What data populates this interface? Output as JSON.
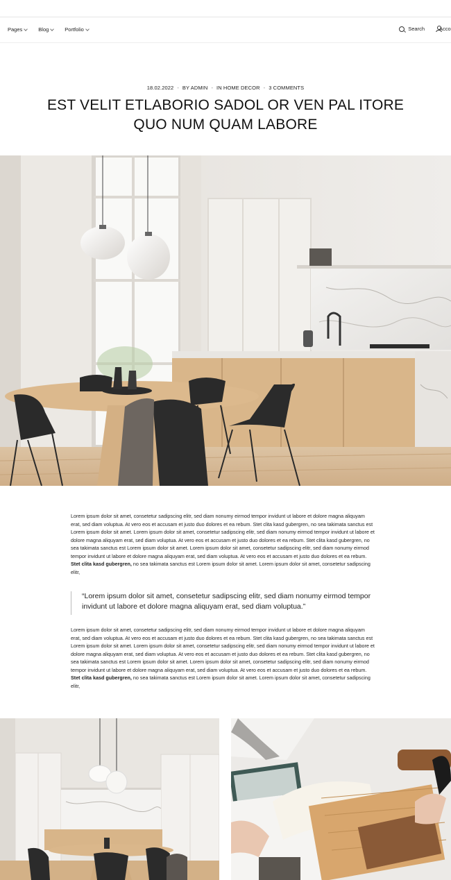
{
  "nav": {
    "items": [
      {
        "label": "Pages"
      },
      {
        "label": "Blog"
      },
      {
        "label": "Portfolio"
      }
    ],
    "search_label": "Search",
    "account_label": "Account"
  },
  "post": {
    "date": "18.02.2022",
    "author": "BY ADMIN",
    "category": "IN HOME DECOR",
    "comments": "3 COMMENTS",
    "title": "EST VELIT ETLABORIO SADOL OR VEN PAL ITORE QUO NUM QUAM LABORE"
  },
  "body": {
    "paragraph1": "Lorem ipsum dolor sit amet, consetetur sadipscing elitr, sed diam nonumy eirmod tempor invidunt ut labore et dolore magna aliquyam erat, sed diam voluptua. At vero eos et accusam et justo duo dolores et ea rebum. Stet clita kasd gubergren, no sea takimata sanctus est Lorem ipsum dolor sit amet. Lorem ipsum dolor sit amet, consetetur sadipscing elitr, sed diam nonumy eirmod tempor invidunt ut labore et dolore magna aliquyam erat, sed diam voluptua. At vero eos et accusam et justo duo dolores et ea rebum. Stet clita kasd gubergren, no sea takimata sanctus est Lorem ipsum dolor sit amet. Lorem ipsum dolor sit amet, consetetur sadipscing elitr, sed diam nonumy eirmod tempor invidunt ut labore et dolore magna aliquyam erat, sed diam voluptua. At vero eos et accusam et justo duo dolores et ea rebum.",
    "paragraph1_bold": "Stet clita kasd gubergren,",
    "paragraph1_tail": "no sea takimata sanctus est Lorem ipsum dolor sit amet. Lorem ipsum dolor sit amet, consetetur sadipscing elitr,",
    "quote": "“Lorem ipsum dolor sit amet, consetetur sadipscing elitr, sed diam nonumy eirmod tempor invidunt ut labore et dolore magna aliquyam erat, sed diam voluptua.”",
    "paragraph2": "Lorem ipsum dolor sit amet, consetetur sadipscing elitr, sed diam nonumy eirmod tempor invidunt ut labore et dolore magna aliquyam erat, sed diam voluptua. At vero eos et accusam et justo duo dolores et ea rebum. Stet clita kasd gubergren, no sea takimata sanctus est Lorem ipsum dolor sit amet. Lorem ipsum dolor sit amet, consetetur sadipscing elitr, sed diam nonumy eirmod tempor invidunt ut labore et dolore magna aliquyam erat, sed diam voluptua. At vero eos et accusam et justo duo dolores et ea rebum. Stet clita kasd gubergren, no sea takimata sanctus est Lorem ipsum dolor sit amet. Lorem ipsum dolor sit amet, consetetur sadipscing elitr, sed diam nonumy eirmod tempor invidunt ut labore et dolore magna aliquyam erat, sed diam voluptua. At vero eos et accusam et justo duo dolores et ea rebum.",
    "paragraph2_bold": "Stet clita kasd gubergren,",
    "paragraph2_tail": "no sea takimata sanctus est Lorem ipsum dolor sit amet. Lorem ipsum dolor sit amet, consetetur sadipscing elitr,"
  },
  "colors": {
    "text": "#111111",
    "divider": "#e6e6e6",
    "wood": "#d8b48a",
    "chair": "#2a2a2a"
  }
}
